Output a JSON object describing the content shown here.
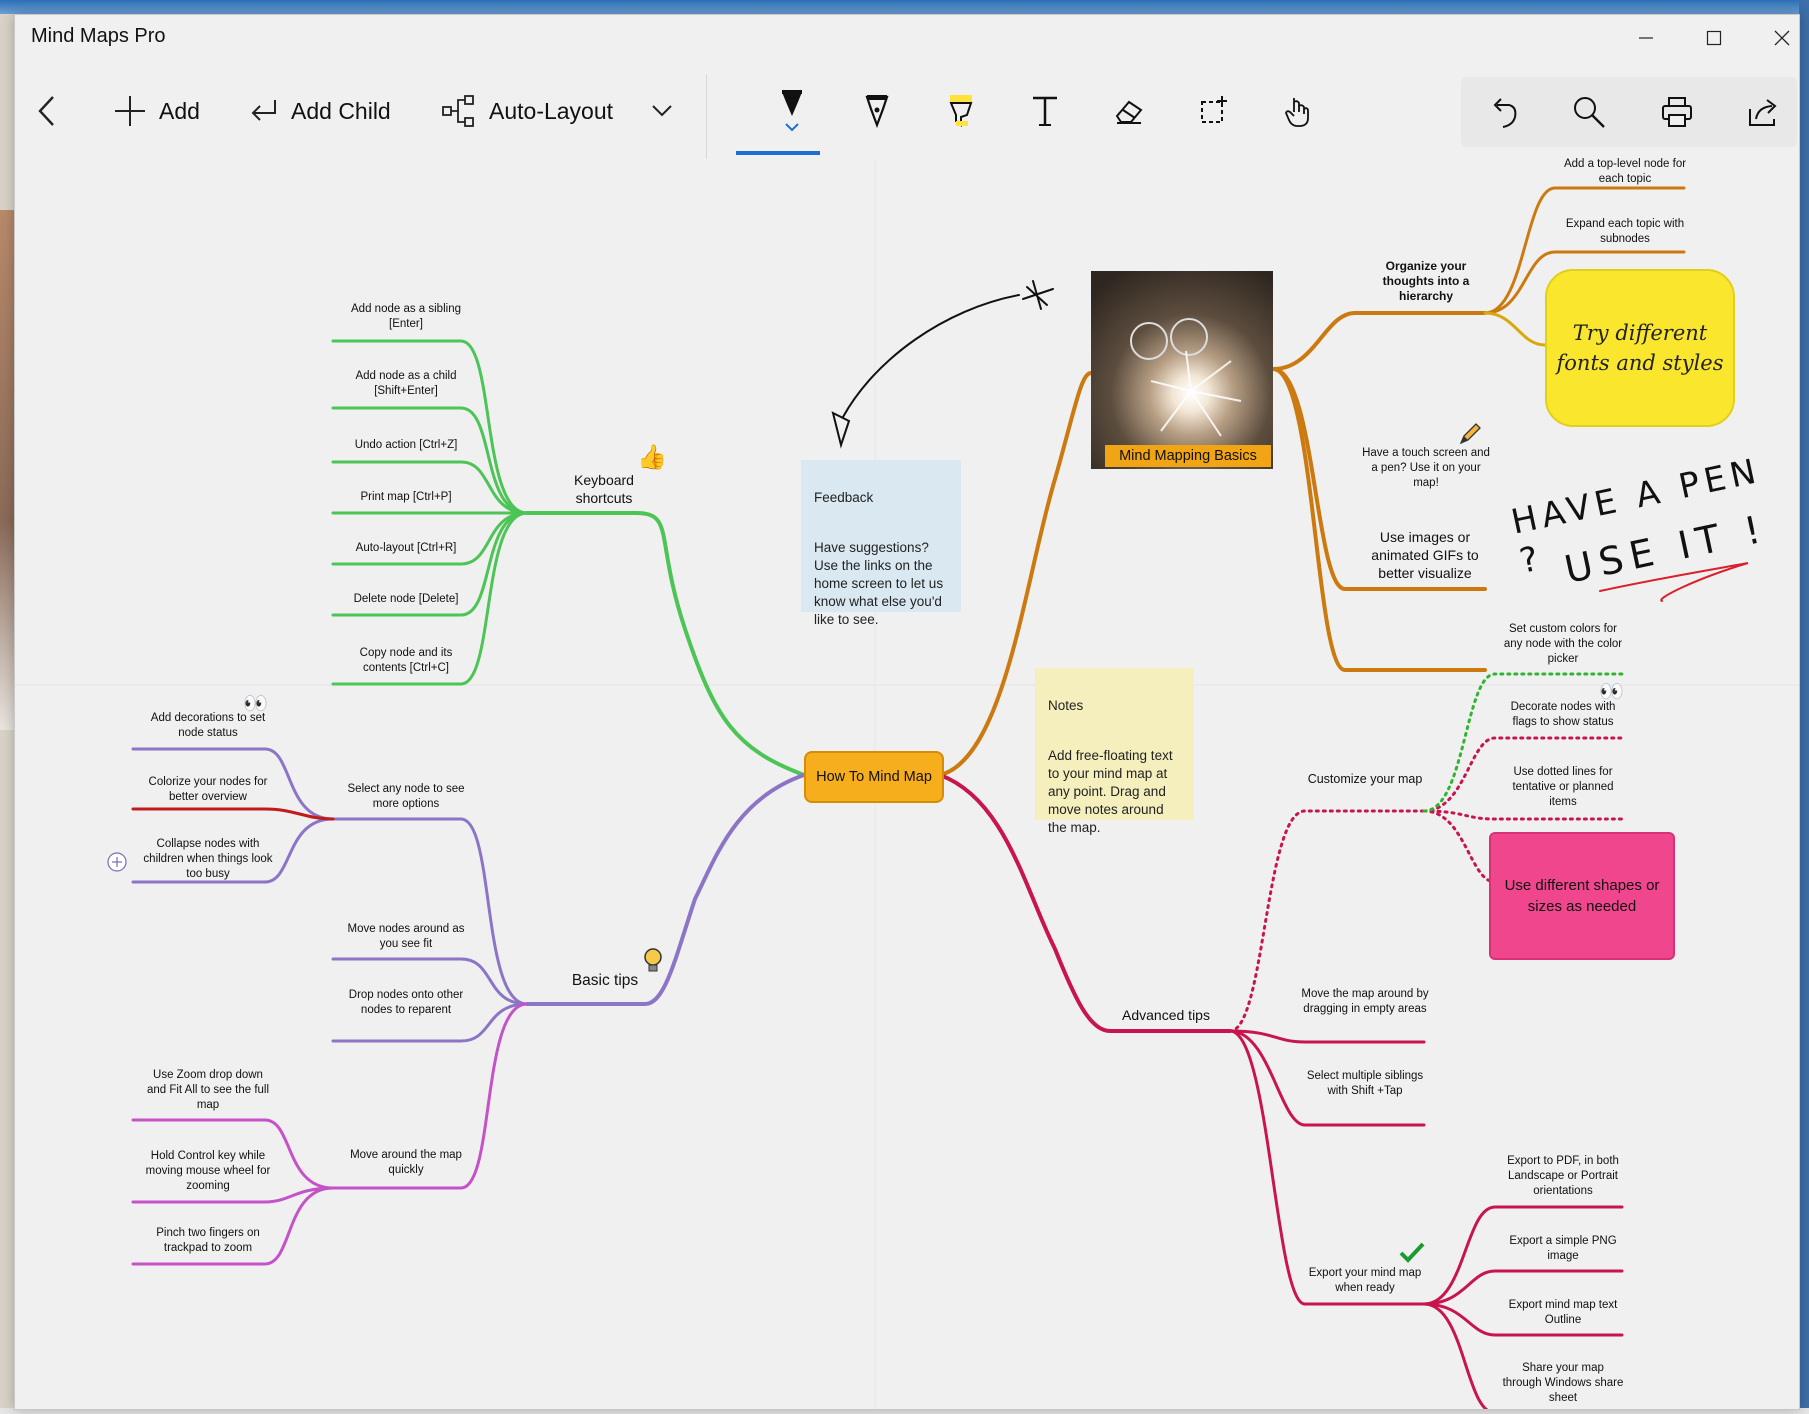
{
  "window": {
    "title": "Mind Maps Pro"
  },
  "toolbar": {
    "back_label": "",
    "add_label": "Add",
    "add_child_label": "Add Child",
    "auto_layout_label": "Auto-Layout"
  },
  "accent_color": "#1f6fd0",
  "icons": [
    "back-arrow",
    "plus",
    "return-arrow",
    "share-nodes",
    "chevron-down",
    "pen",
    "fountain-pen",
    "highlighter",
    "text-T",
    "eraser",
    "lasso-select",
    "hand-pointer",
    "undo",
    "search",
    "print",
    "share"
  ],
  "map": {
    "central": "How To Mind Map",
    "branches": {
      "keyboard": {
        "label": "Keyboard shortcuts",
        "color": "#4cc456",
        "children": [
          "Add node as a sibling [Enter]",
          "Add node as a child [Shift+Enter]",
          "Undo action [Ctrl+Z]",
          "Print map [Ctrl+P]",
          "Auto-layout [Ctrl+R]",
          "Delete node [Delete]",
          "Copy node and its contents [Ctrl+C]"
        ]
      },
      "basic": {
        "label": "Basic tips",
        "color": "#8c74c6",
        "select": {
          "label": "Select any node to see more options",
          "children": [
            "Add decorations to set node status",
            "Colorize your nodes for better overview",
            "Collapse nodes with children when things look too busy"
          ]
        },
        "move_nodes": "Move nodes around as you see fit",
        "drop_nodes": "Drop nodes onto other nodes to reparent",
        "move_map": {
          "label": "Move around the map quickly",
          "color": "#c452c9",
          "children": [
            "Use Zoom drop down and Fit All to see the full map",
            "Hold Control key while moving mouse wheel for zooming",
            "Pinch two fingers on trackpad to zoom"
          ]
        }
      },
      "basics": {
        "label": "Mind Mapping Basics",
        "color": "#cc7a10",
        "organize": {
          "label": "Organize your thoughts into a hierarchy",
          "children": [
            "Add a top-level node for each topic",
            "Expand each topic with subnodes"
          ]
        },
        "fonts": "Try different fonts and styles",
        "pen": "Have a touch screen and a pen? Use it on your map!",
        "images": "Use images or animated GIFs to better visualize"
      },
      "advanced": {
        "label": "Advanced tips",
        "color": "#c8154e",
        "customize": {
          "label": "Customize your map",
          "children": [
            "Set custom colors for any node with the color picker",
            "Decorate nodes with flags to show status",
            "Use dotted lines for tentative or planned items"
          ],
          "shapes": "Use different shapes or sizes as needed"
        },
        "move_map": "Move the map around by dragging in empty areas",
        "select_multiple": "Select multiple siblings with Shift +Tap",
        "export": {
          "label": "Export your mind map when ready",
          "children": [
            "Export to PDF, in both Landscape or Portrait orientations",
            "Export a simple PNG image",
            "Export mind map text Outline",
            "Share your map through Windows share sheet"
          ]
        }
      }
    },
    "notes": {
      "feedback": {
        "title": "Feedback",
        "body": "Have suggestions? Use the links on the home screen to let us know what else you'd like to see."
      },
      "notes": {
        "title": "Notes",
        "body": "Add free-floating text to your mind map at any point. Drag and move notes around the map."
      }
    },
    "handwriting": {
      "line1": "HAVE A PEN ?",
      "line2": "USE IT !"
    }
  }
}
